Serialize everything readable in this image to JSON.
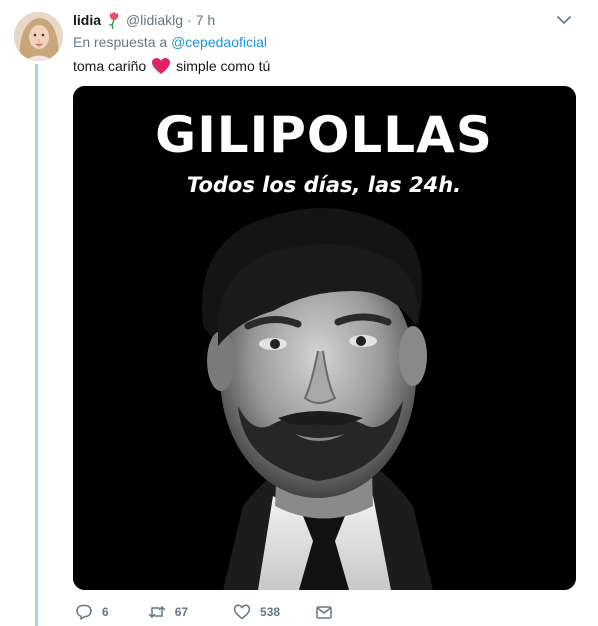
{
  "tweet": {
    "display_name": "lidia",
    "handle": "@lidiaklg",
    "separator": "·",
    "time": "7 h",
    "reply_prefix": "En respuesta a",
    "reply_to": "@cepedaoficial",
    "text_before": "toma cariño",
    "text_after": "simple como tú"
  },
  "media": {
    "headline": "GILIPOLLAS",
    "subline": "Todos los días, las 24h."
  },
  "actions": {
    "replies": "6",
    "retweets": "67",
    "likes": "538"
  },
  "colors": {
    "link": "#1b95e0",
    "muted": "#657786",
    "thread_line": "#a9d3e8",
    "heart": "#e0245e"
  },
  "icons": [
    "avatar",
    "flower-badge-icon",
    "chevron-down-icon",
    "heart-emoji-icon",
    "reply-icon",
    "retweet-icon",
    "like-icon",
    "direct-message-icon"
  ]
}
